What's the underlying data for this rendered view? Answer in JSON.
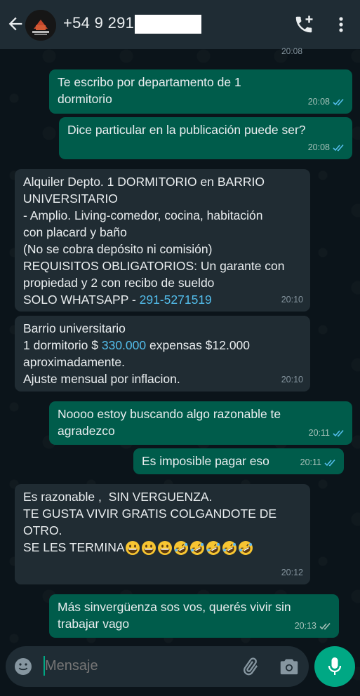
{
  "header": {
    "phone": "+54 9 291",
    "avatar_text": "PARTICULAR"
  },
  "previous_time": "20:08",
  "messages": [
    {
      "dir": "out",
      "text": "Te escribo por departamento de 1\ndormitorio",
      "time": "20:08",
      "status": "read"
    },
    {
      "dir": "out",
      "text": "Dice particular en la publicación puede ser?",
      "time": "20:08",
      "status": "read"
    },
    {
      "dir": "in",
      "text_a": "Alquiler Depto. 1 DORMITORIO en BARRIO\nUNIVERSITARIO\n- Amplio. Living-comedor, cocina, habitación\ncon placard y baño\n(No se cobra depósito ni comisión)\nREQUISITOS OBLIGATORIOS: Un garante con\npropiedad y 2 con recibo de sueldo\nSOLO WHATSAPP - ",
      "link": "291-5271519",
      "time": "20:10"
    },
    {
      "dir": "in",
      "text_a": "Barrio universitario\n1 dormitorio $ ",
      "link": "330.000",
      "text_b": " expensas $12.000\naproximadamente.\nAjuste mensual por inflacion.",
      "time": "20:10"
    },
    {
      "dir": "out",
      "text": "Noooo estoy buscando algo razonable te\nagradezco",
      "time": "20:11",
      "status": "read"
    },
    {
      "dir": "out",
      "text": "Es imposible pagar eso",
      "time": "20:11",
      "status": "read"
    },
    {
      "dir": "in",
      "text": "Es razonable ,  SIN VERGUENZA.\nTE GUSTA VIVIR GRATIS COLGANDOTE DE\nOTRO.\nSE LES TERMINA",
      "emoji": [
        "grinning",
        "grinning",
        "grinning",
        "rofl",
        "rofl",
        "rofl",
        "rofl",
        "rofl"
      ],
      "time": "20:12"
    },
    {
      "dir": "out",
      "text": "Más sinvergüenza sos vos, querés vivir sin\ntrabajar vago",
      "time": "20:13",
      "status": "delivered"
    }
  ],
  "input": {
    "placeholder": "Mensaje"
  },
  "icons": {
    "back": "arrow-left-icon",
    "call": "add-call-icon",
    "menu": "more-vert-icon",
    "emoji": "emoji-icon",
    "attach": "paperclip-icon",
    "camera": "camera-icon",
    "mic": "mic-icon"
  },
  "colors": {
    "accent": "#00a884",
    "outgoing": "#005c4b",
    "incoming": "#202c33",
    "link": "#53bdeb",
    "read_ticks": "#53bdeb"
  }
}
